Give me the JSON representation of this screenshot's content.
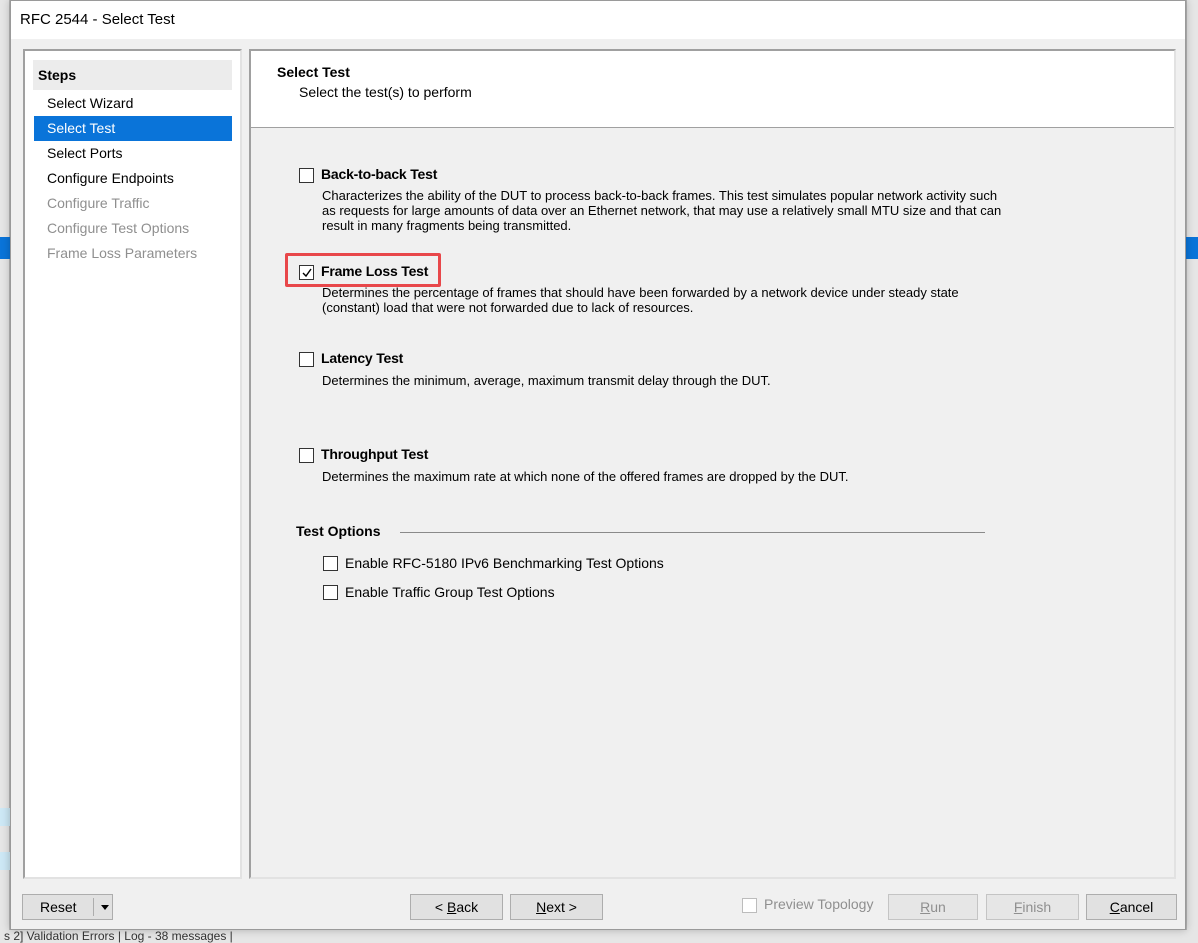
{
  "window": {
    "title": "RFC 2544 - Select Test"
  },
  "steps": {
    "heading": "Steps",
    "items": [
      {
        "label": "Select Wizard"
      },
      {
        "label": "Select Test"
      },
      {
        "label": "Select Ports"
      },
      {
        "label": "Configure Endpoints"
      },
      {
        "label": "Configure Traffic"
      },
      {
        "label": "Configure Test Options"
      },
      {
        "label": "Frame Loss Parameters"
      }
    ]
  },
  "main": {
    "title": "Select Test",
    "subtitle": "Select the test(s) to perform",
    "tests": [
      {
        "label": "Back-to-back Test",
        "checked": false,
        "description": "Characterizes the ability of the DUT to process back-to-back frames. This test simulates popular network activity such as requests for large amounts of data over an Ethernet network, that may use a relatively small MTU size and that can result in many fragments being transmitted."
      },
      {
        "label": "Frame Loss Test",
        "checked": true,
        "description": "Determines the percentage of frames that should have been forwarded by a network device under steady state (constant) load that were not forwarded due to lack of resources."
      },
      {
        "label": "Latency Test",
        "checked": false,
        "description": "Determines the minimum, average, maximum transmit delay through the DUT."
      },
      {
        "label": "Throughput Test",
        "checked": false,
        "description": "Determines the maximum rate at which none of the offered frames are dropped by the DUT."
      }
    ],
    "options": {
      "title": "Test Options",
      "items": [
        {
          "label": "Enable RFC-5180 IPv6 Benchmarking Test Options",
          "checked": false
        },
        {
          "label": "Enable Traffic Group Test Options",
          "checked": false
        }
      ]
    }
  },
  "footer": {
    "reset": "Reset",
    "back": {
      "prefix": "< ",
      "mnemonic": "B",
      "rest": "ack"
    },
    "next": {
      "mnemonic": "N",
      "rest": "ext >"
    },
    "preview": "Preview Topology",
    "run": {
      "mnemonic": "R",
      "rest": "un"
    },
    "finish": {
      "mnemonic": "F",
      "rest": "inish"
    },
    "cancel": {
      "mnemonic": "C",
      "rest": "ancel"
    }
  },
  "background": {
    "status_text": "s 2] Validation Errors | Log - 38 messages |"
  },
  "colors": {
    "selection": "#0a74d9",
    "highlight_box": "#e8474a"
  }
}
